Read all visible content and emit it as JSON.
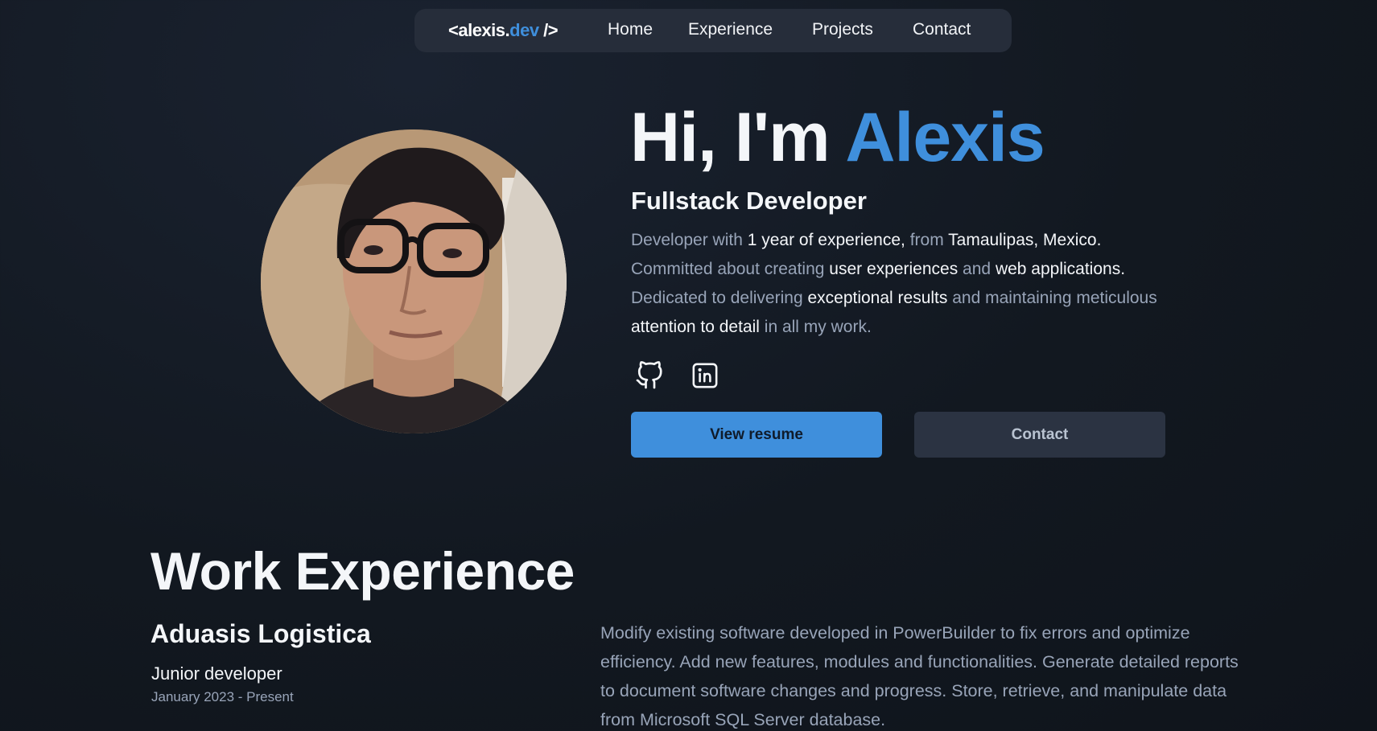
{
  "nav": {
    "logo_open": "<alexis.",
    "logo_accent": "dev",
    "logo_close": " />",
    "links": [
      "Home",
      "Experience",
      "Projects",
      "Contact"
    ]
  },
  "hero": {
    "greeting": "Hi, I'm ",
    "name": "Alexis",
    "subtitle": "Fullstack Developer",
    "bio": [
      {
        "text": "Developer with ",
        "hl": false
      },
      {
        "text": "1 year of experience,",
        "hl": true
      },
      {
        "text": " from ",
        "hl": false
      },
      {
        "text": "Tamaulipas, Mexico.",
        "hl": true
      },
      {
        "text": " Committed about creating ",
        "hl": false
      },
      {
        "text": "user experiences",
        "hl": true
      },
      {
        "text": " and ",
        "hl": false
      },
      {
        "text": "web applications.",
        "hl": true
      },
      {
        "text": " Dedicated to delivering ",
        "hl": false
      },
      {
        "text": "exceptional results",
        "hl": true
      },
      {
        "text": " and maintaining meticulous ",
        "hl": false
      },
      {
        "text": "attention to detail",
        "hl": true
      },
      {
        "text": " in all my work.",
        "hl": false
      }
    ],
    "social": [
      {
        "icon": "github-icon"
      },
      {
        "icon": "linkedin-icon"
      }
    ],
    "primary_button": "View resume",
    "secondary_button": "Contact"
  },
  "experience": {
    "title": "Work Experience",
    "company": "Aduasis Logistica",
    "role": "Junior developer",
    "dates": "January 2023 - Present",
    "description": "Modify existing software developed in PowerBuilder to fix errors and optimize efficiency. Add new features, modules and functionalities. Generate detailed reports to document software changes and progress. Store, retrieve, and manipulate data from Microsoft SQL Server database."
  },
  "colors": {
    "accent": "#3f8fdc",
    "background": "#121820",
    "nav_bg": "#262d3a",
    "muted_text": "#98a4b8"
  }
}
